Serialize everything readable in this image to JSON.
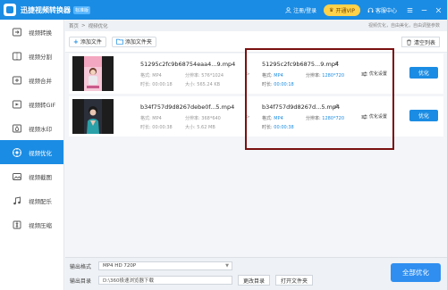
{
  "app": {
    "title": "迅捷视频转换器",
    "edition": "标准版",
    "login": "注册/登录",
    "vip": "开通VIP",
    "support": "客服中心"
  },
  "sidebar": {
    "items": [
      {
        "label": "视频转换",
        "icon": "video-convert-icon"
      },
      {
        "label": "视频分割",
        "icon": "video-split-icon"
      },
      {
        "label": "视频合并",
        "icon": "video-merge-icon"
      },
      {
        "label": "视频转GIF",
        "icon": "video-gif-icon"
      },
      {
        "label": "视频水印",
        "icon": "video-watermark-icon"
      },
      {
        "label": "视频优化",
        "icon": "video-optimize-icon",
        "active": true
      },
      {
        "label": "视频截图",
        "icon": "video-screenshot-icon"
      },
      {
        "label": "视频配乐",
        "icon": "video-music-icon"
      },
      {
        "label": "视频压缩",
        "icon": "video-compress-icon"
      }
    ]
  },
  "breadcrumb": {
    "home": "首页",
    "current": "视频优化",
    "hint": "视频优化，自由美化，自由调整参数"
  },
  "toolbar": {
    "add_file": "添加文件",
    "add_folder": "添加文件夹",
    "clear_list": "清空列表"
  },
  "files": [
    {
      "src_name": "51295c2fc9b68754eaa4...9.mp4",
      "format_label": "格式:",
      "format": "MP4",
      "res_label": "分辨率:",
      "resolution": "576*1024",
      "duration_label": "时长:",
      "duration": "00:00:18",
      "size_label": "大小:",
      "size": "565.24 KB",
      "dst_name": "51295c2fc9b6875...9.mp4",
      "dst_format": "MP4",
      "dst_resolution": "1280*720",
      "dst_duration": "00:00:18",
      "settings": "优化设置",
      "button": "优化"
    },
    {
      "src_name": "b34f757d9d8267debe0f...5.mp4",
      "format_label": "格式:",
      "format": "MP4",
      "res_label": "分辨率:",
      "resolution": "368*640",
      "duration_label": "时长:",
      "duration": "00:00:38",
      "size_label": "大小:",
      "size": "5.62 MB",
      "dst_name": "b34f757d9d8267d...5.mp4",
      "dst_format": "MP4",
      "dst_resolution": "1280*720",
      "dst_duration": "00:00:38",
      "settings": "优化设置",
      "button": "优化"
    }
  ],
  "footer": {
    "format_label": "输出格式",
    "format_value": "MP4  HD 720P",
    "dir_label": "输出目录",
    "dir_value": "D:\\360极速浏览器下载",
    "change_dir": "更改目录",
    "open_folder": "打开文件夹",
    "convert_all": "全部优化"
  },
  "colors": {
    "accent": "#1b8ce3",
    "highlight_border": "#7a1010",
    "vip": "#ffd24a"
  }
}
